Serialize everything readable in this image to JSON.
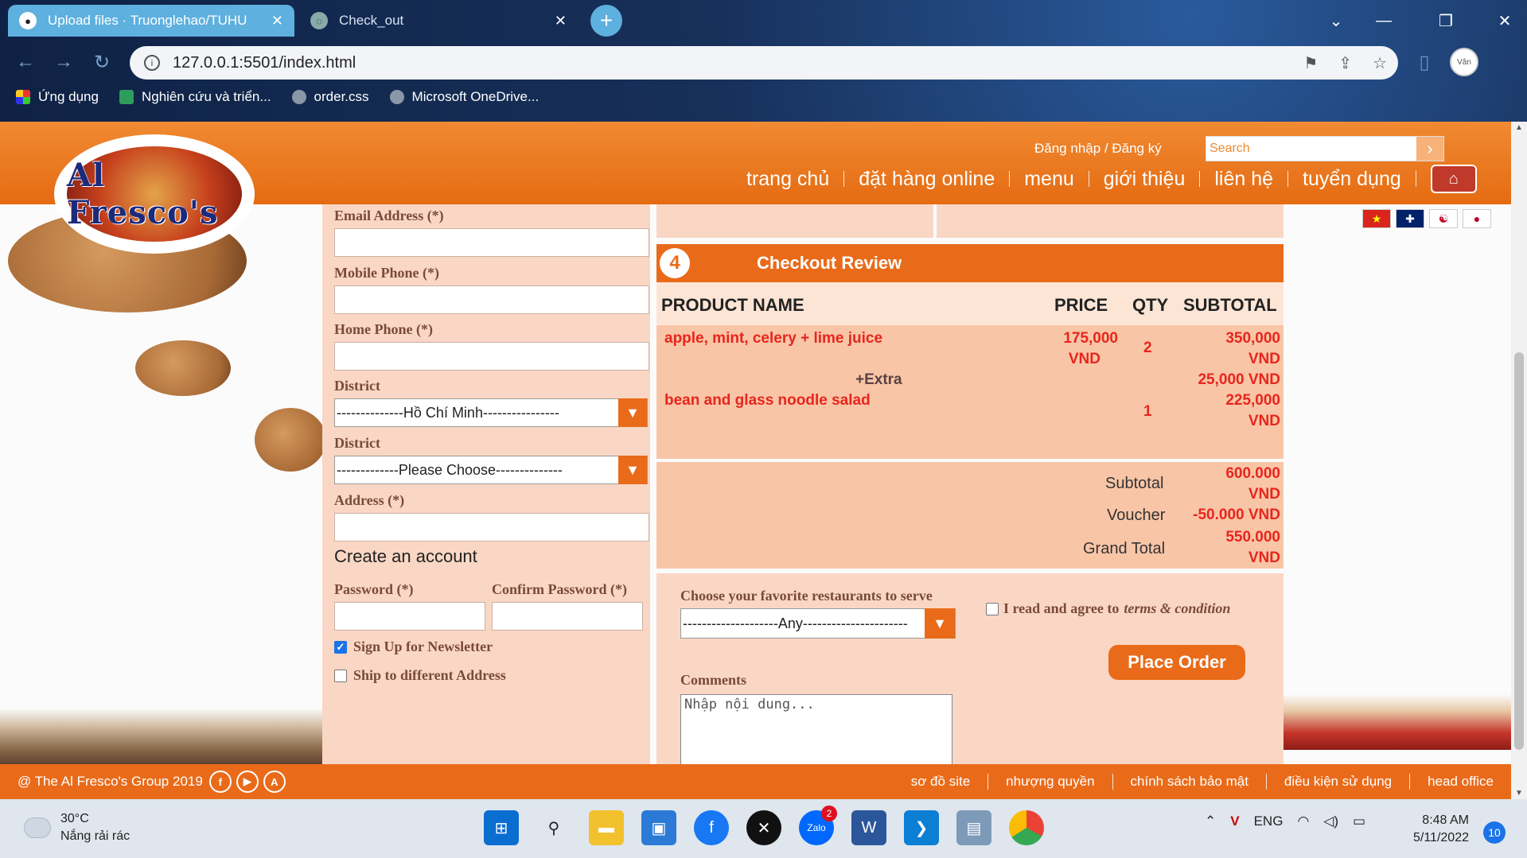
{
  "browser": {
    "tabs": [
      {
        "title": "Upload files · Truonglehao/TUHU",
        "active": true,
        "icon": "github-icon"
      },
      {
        "title": "Check_out",
        "active": false,
        "icon": "globe-icon"
      }
    ],
    "url": "127.0.0.1:5501/index.html",
    "bookmarks": [
      {
        "label": "Ứng dụng",
        "icon": "apps-grid-icon"
      },
      {
        "label": "Nghiên cứu và triển...",
        "icon": "doc-icon"
      },
      {
        "label": "order.css",
        "icon": "globe-icon"
      },
      {
        "label": "Microsoft OneDrive...",
        "icon": "globe-icon"
      }
    ]
  },
  "site": {
    "logo_text": "Al Fresco's",
    "auth_link": "Đăng nhập / Đăng ký",
    "search_placeholder": "Search",
    "nav": [
      "trang chủ",
      "đặt hàng online",
      "menu",
      "giới thiệu",
      "liên hệ",
      "tuyển dụng"
    ],
    "flags": [
      "vn-flag",
      "uk-flag",
      "kr-flag",
      "jp-flag"
    ]
  },
  "form": {
    "email_label": "Email Address (*)",
    "mobile_label": "Mobile Phone (*)",
    "home_label": "Home Phone (*)",
    "district1_label": "District",
    "district1_value": "--------------Hồ Chí Minh----------------",
    "district2_label": "District",
    "district2_value": "-------------Please Choose--------------",
    "address_label": "Address (*)",
    "create_account": "Create an account",
    "password_label": "Password (*)",
    "confirm_label": "Confirm Password (*)",
    "newsletter_label": "Sign Up for Newsletter",
    "newsletter_checked": true,
    "ship_label": "Ship to different Address",
    "ship_checked": false
  },
  "review": {
    "step": "4",
    "title": "Checkout Review",
    "columns": [
      "PRODUCT NAME",
      "PRICE",
      "QTY",
      "SUBTOTAL"
    ],
    "items": [
      {
        "name": "apple, mint, celery + lime juice",
        "price_line1": "175,000",
        "price_line2": "VND",
        "qty": "2",
        "subtotal_line1": "350,000",
        "subtotal_line2": "VND"
      },
      {
        "extra_label": "+Extra",
        "extra_value": "25,000 VND"
      },
      {
        "name": "bean and glass noodle salad",
        "qty": "1",
        "subtotal_line1": "225,000",
        "subtotal_line2": "VND"
      }
    ],
    "subtotal_label": "Subtotal",
    "subtotal_line1": "600.000",
    "subtotal_line2": "VND",
    "voucher_label": "Voucher",
    "voucher_value": "-50.000 VND",
    "grand_label": "Grand Total",
    "grand_line1": "550.000",
    "grand_line2": "VND"
  },
  "order": {
    "restaurant_label": "Choose your favorite restaurants to serve",
    "restaurant_value": "--------------------Any----------------------",
    "agree_prefix": "I read and agree to ",
    "agree_terms": "terms & condition",
    "place_order": "Place Order",
    "comments_label": "Comments",
    "comments_placeholder": "Nhập nội dung..."
  },
  "footer": {
    "copyright": "@ The Al Fresco's Group 2019",
    "links": [
      "sơ đồ site",
      "nhượng quyền",
      "chính sách bảo mật",
      "điều kiện sử dụng",
      "head office"
    ]
  },
  "taskbar": {
    "temp": "30°C",
    "weather": "Nắng rải rác",
    "lang": "ENG",
    "time": "8:48 AM",
    "date": "5/11/2022",
    "notifications": "10",
    "zalo_badge": "2"
  }
}
